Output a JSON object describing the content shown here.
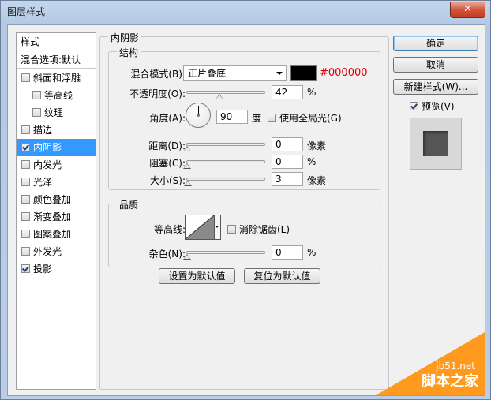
{
  "window": {
    "title": "图层样式",
    "close_glyph": "✕"
  },
  "styles_panel": {
    "header": "样式",
    "blend_options": "混合选项:默认",
    "items": [
      {
        "label": "斜面和浮雕",
        "checked": false,
        "indent": false
      },
      {
        "label": "等高线",
        "checked": false,
        "indent": true
      },
      {
        "label": "纹理",
        "checked": false,
        "indent": true
      },
      {
        "label": "描边",
        "checked": false,
        "indent": false
      },
      {
        "label": "内阴影",
        "checked": true,
        "indent": false,
        "selected": true
      },
      {
        "label": "内发光",
        "checked": false,
        "indent": false
      },
      {
        "label": "光泽",
        "checked": false,
        "indent": false
      },
      {
        "label": "颜色叠加",
        "checked": false,
        "indent": false
      },
      {
        "label": "渐变叠加",
        "checked": false,
        "indent": false
      },
      {
        "label": "图案叠加",
        "checked": false,
        "indent": false
      },
      {
        "label": "外发光",
        "checked": false,
        "indent": false
      },
      {
        "label": "投影",
        "checked": true,
        "indent": false
      }
    ]
  },
  "inner_shadow": {
    "title": "内阴影",
    "structure": {
      "title": "结构",
      "blend_mode_label": "混合模式(B):",
      "blend_mode_value": "正片叠底",
      "color_hex": "#000000",
      "opacity_label": "不透明度(O):",
      "opacity_value": "42",
      "opacity_unit": "%",
      "angle_label": "角度(A):",
      "angle_value": "90",
      "angle_unit": "度",
      "global_light_label": "使用全局光(G)",
      "distance_label": "距离(D):",
      "distance_value": "0",
      "distance_unit": "像素",
      "choke_label": "阻塞(C):",
      "choke_value": "0",
      "choke_unit": "%",
      "size_label": "大小(S):",
      "size_value": "3",
      "size_unit": "像素"
    },
    "quality": {
      "title": "品质",
      "contour_label": "等高线:",
      "antialias_label": "消除锯齿(L)",
      "noise_label": "杂色(N):",
      "noise_value": "0",
      "noise_unit": "%"
    },
    "make_default": "设置为默认值",
    "reset_default": "复位为默认值"
  },
  "right": {
    "ok": "确定",
    "cancel": "取消",
    "new_style": "新建样式(W)...",
    "preview_label": "预览(V)"
  },
  "watermark": {
    "site": "jb51.net",
    "brand": "脚本之家"
  },
  "colors": {
    "selection": "#3399ff",
    "swatch": "#000000",
    "hex_text": "#e00000",
    "watermark": "#ff9a1e"
  }
}
